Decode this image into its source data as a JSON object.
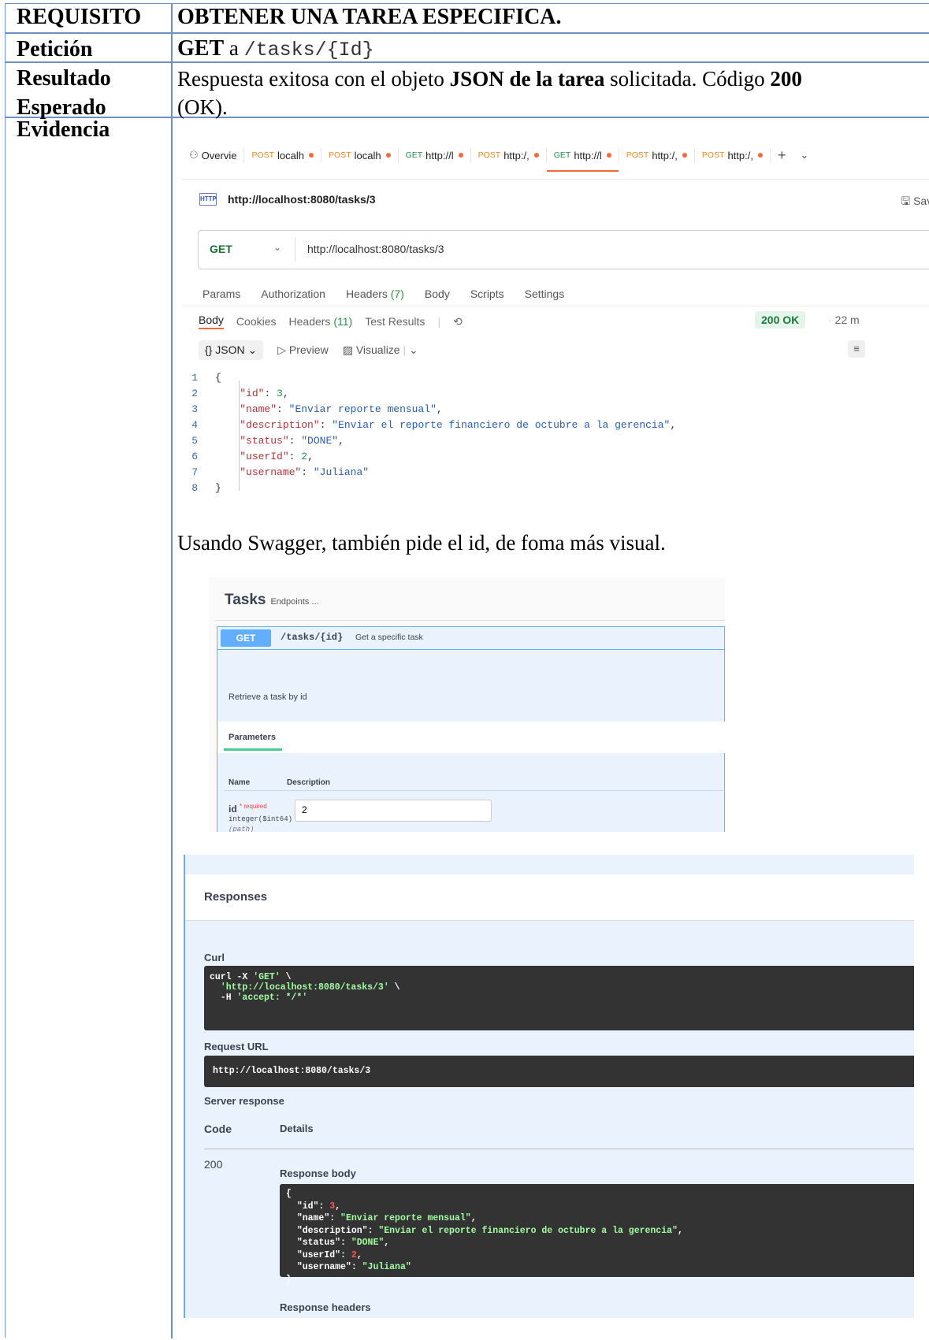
{
  "doc": {
    "req_label": "REQUISITO",
    "req_value": "OBTENER UNA TAREA ESPECIFICA.",
    "pet_label": "Petición",
    "pet_method": "GET",
    "pet_a": "a",
    "pet_path": "/tasks/{Id}",
    "res_label1": "Resultado",
    "res_label2": "Esperado",
    "res_t1": "Respuesta exitosa con el objeto ",
    "res_b1": "JSON de la tarea",
    "res_t2": " solicitada. Código ",
    "res_b2": "200",
    "res_t3": "(OK).",
    "ev_label": "Evidencia",
    "sentence": "Usando Swagger, también pide el id, de foma más visual."
  },
  "postman": {
    "tabs": [
      {
        "method": "",
        "label": "Overvie"
      },
      {
        "method": "POST",
        "label": "localh",
        "dot": true
      },
      {
        "method": "POST",
        "label": "localh",
        "dot": true
      },
      {
        "method": "GET",
        "label": "http://l",
        "dot": true
      },
      {
        "method": "POST",
        "label": "http:/,",
        "dot": true
      },
      {
        "method": "GET",
        "label": "http://l",
        "dot": true
      },
      {
        "method": "POST",
        "label": "http:/,",
        "dot": true
      },
      {
        "method": "POST",
        "label": "http:/,",
        "dot": true
      }
    ],
    "http_icon": "HTTP",
    "title_url": "http://localhost:8080/tasks/3",
    "save": "Save",
    "method": "GET",
    "url": "http://localhost:8080/tasks/3",
    "req_tabs": [
      "Params",
      "Authorization",
      "Headers",
      "(7)",
      "Body",
      "Scripts",
      "Settings"
    ],
    "resp_tabs": [
      "Body",
      "Cookies",
      "Headers",
      "(11)",
      "Test Results"
    ],
    "status": "200 OK",
    "time": "22 m",
    "view": [
      "{} JSON",
      "Preview",
      "Visualize"
    ],
    "json_lines": [
      {
        "n": "1",
        "p": "{"
      },
      {
        "n": "2",
        "k": "\"id\"",
        "v": "3",
        "t": "n"
      },
      {
        "n": "3",
        "k": "\"name\"",
        "v": "\"Enviar reporte mensual\"",
        "t": "s"
      },
      {
        "n": "4",
        "k": "\"description\"",
        "v": "\"Enviar el reporte financiero de octubre a la gerencia\"",
        "t": "s"
      },
      {
        "n": "5",
        "k": "\"status\"",
        "v": "\"DONE\"",
        "t": "s"
      },
      {
        "n": "6",
        "k": "\"userId\"",
        "v": "2",
        "t": "n"
      },
      {
        "n": "7",
        "k": "\"username\"",
        "v": "\"Juliana\"",
        "t": "s",
        "last": true
      },
      {
        "n": "8",
        "p": "}"
      }
    ]
  },
  "swagger": {
    "title": "Tasks",
    "subtitle": "Endpoints ...",
    "get": "GET",
    "path": "/tasks/{id}",
    "summary": "Get a specific task",
    "desc": "Retrieve a task by id",
    "parameters": "Parameters",
    "col_name": "Name",
    "col_desc": "Description",
    "param_name": "id",
    "required": "* required",
    "param_type": "integer($int64)",
    "param_in": "(path)",
    "param_value": "2",
    "responses": "Responses",
    "curl_label": "Curl",
    "curl_1": "curl -X ",
    "curl_1s": "'GET'",
    "curl_1e": " \\",
    "curl_2s": "  'http://localhost:8080/tasks/3'",
    "curl_2e": " \\",
    "curl_3": "  -H ",
    "curl_3s": "'accept: */*'",
    "req_url_label": "Request URL",
    "req_url": "http://localhost:8080/tasks/3",
    "server_resp": "Server response",
    "code_h": "Code",
    "details_h": "Details",
    "code": "200",
    "resp_body": "Response body",
    "resp_headers": "Response headers",
    "body_lines": [
      {
        "p": "{"
      },
      {
        "k": "\"id\"",
        "v": "3",
        "t": "n"
      },
      {
        "k": "\"name\"",
        "v": "\"Enviar reporte mensual\"",
        "t": "s"
      },
      {
        "k": "\"description\"",
        "v": "\"Enviar el reporte financiero de octubre a la gerencia\"",
        "t": "s"
      },
      {
        "k": "\"status\"",
        "v": "\"DONE\"",
        "t": "s"
      },
      {
        "k": "\"userId\"",
        "v": "2",
        "t": "n"
      },
      {
        "k": "\"username\"",
        "v": "\"Juliana\"",
        "t": "s",
        "last": true
      },
      {
        "p": "}"
      }
    ]
  }
}
